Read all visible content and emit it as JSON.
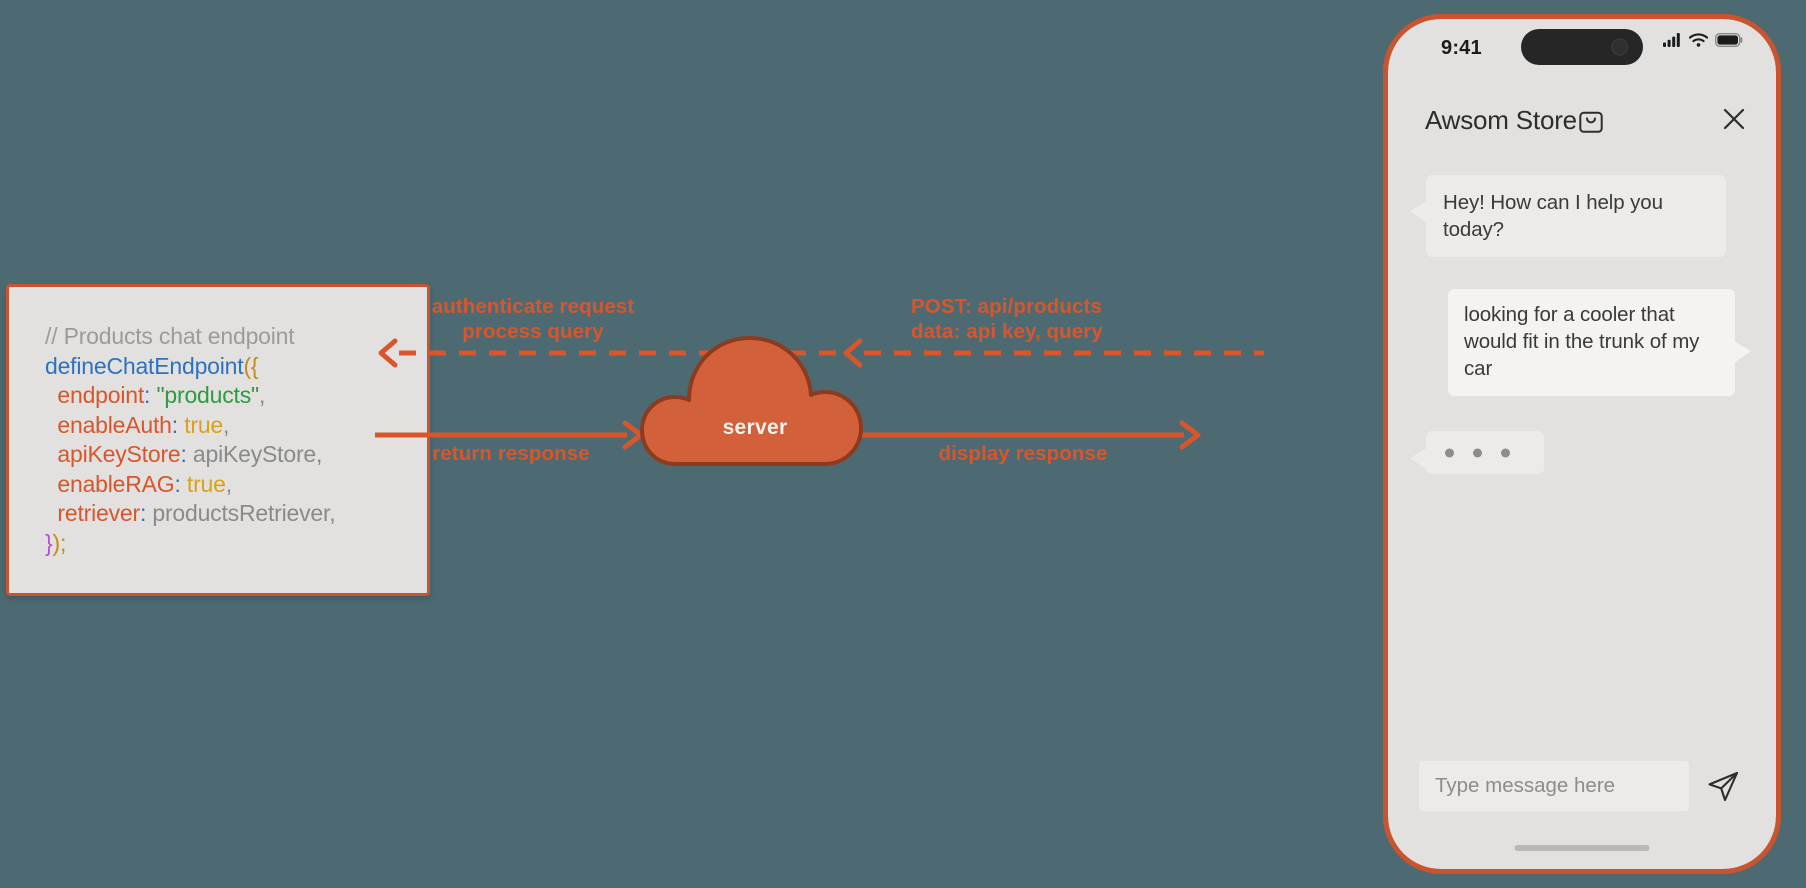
{
  "canvas": {
    "background_color": "#4D6A73",
    "accent_color": "#D8562B",
    "frame_color": "#C9542E"
  },
  "code_panel": {
    "comment": "// Products chat endpoint",
    "fn_name": "defineChatEndpoint",
    "open": "({",
    "lines": [
      {
        "key": "endpoint",
        "value": "\"products\"",
        "kind": "string"
      },
      {
        "key": "enableAuth",
        "value": "true",
        "kind": "bool"
      },
      {
        "key": "apiKeyStore",
        "value": "apiKeyStore",
        "kind": "ident"
      },
      {
        "key": "enableRAG",
        "value": "true",
        "kind": "bool"
      },
      {
        "key": "retriever",
        "value": "productsRetriever",
        "kind": "ident"
      }
    ],
    "close": "});"
  },
  "server": {
    "label": "server",
    "icon": "cloud-icon",
    "fill": "#D2603A",
    "stroke": "#8C3B1F"
  },
  "arrows": {
    "authenticate": {
      "label": "authenticate request\nprocess query",
      "style": "dashed",
      "direction": "left"
    },
    "post": {
      "label": "POST: api/products\ndata: api key, query",
      "style": "dashed",
      "direction": "left"
    },
    "return_response": {
      "label": "return response",
      "style": "solid",
      "direction": "right"
    },
    "display_response": {
      "label": "display response",
      "style": "solid",
      "direction": "right"
    }
  },
  "phone": {
    "status": {
      "time": "9:41",
      "signal_icon": "cellular-signal-icon",
      "wifi_icon": "wifi-icon",
      "battery_icon": "battery-full-icon"
    },
    "header": {
      "title": "Awsom Store",
      "bag_icon": "shopping-bag-icon",
      "close_icon": "close-icon"
    },
    "messages": [
      {
        "from": "bot",
        "text": "Hey! How can I help you today?"
      },
      {
        "from": "user",
        "text": "looking for a cooler that would fit in the trunk of my car"
      },
      {
        "from": "bot",
        "text": "",
        "typing": true
      }
    ],
    "composer": {
      "placeholder": "Type message here",
      "value": "",
      "send_icon": "send-paper-plane-icon"
    }
  }
}
